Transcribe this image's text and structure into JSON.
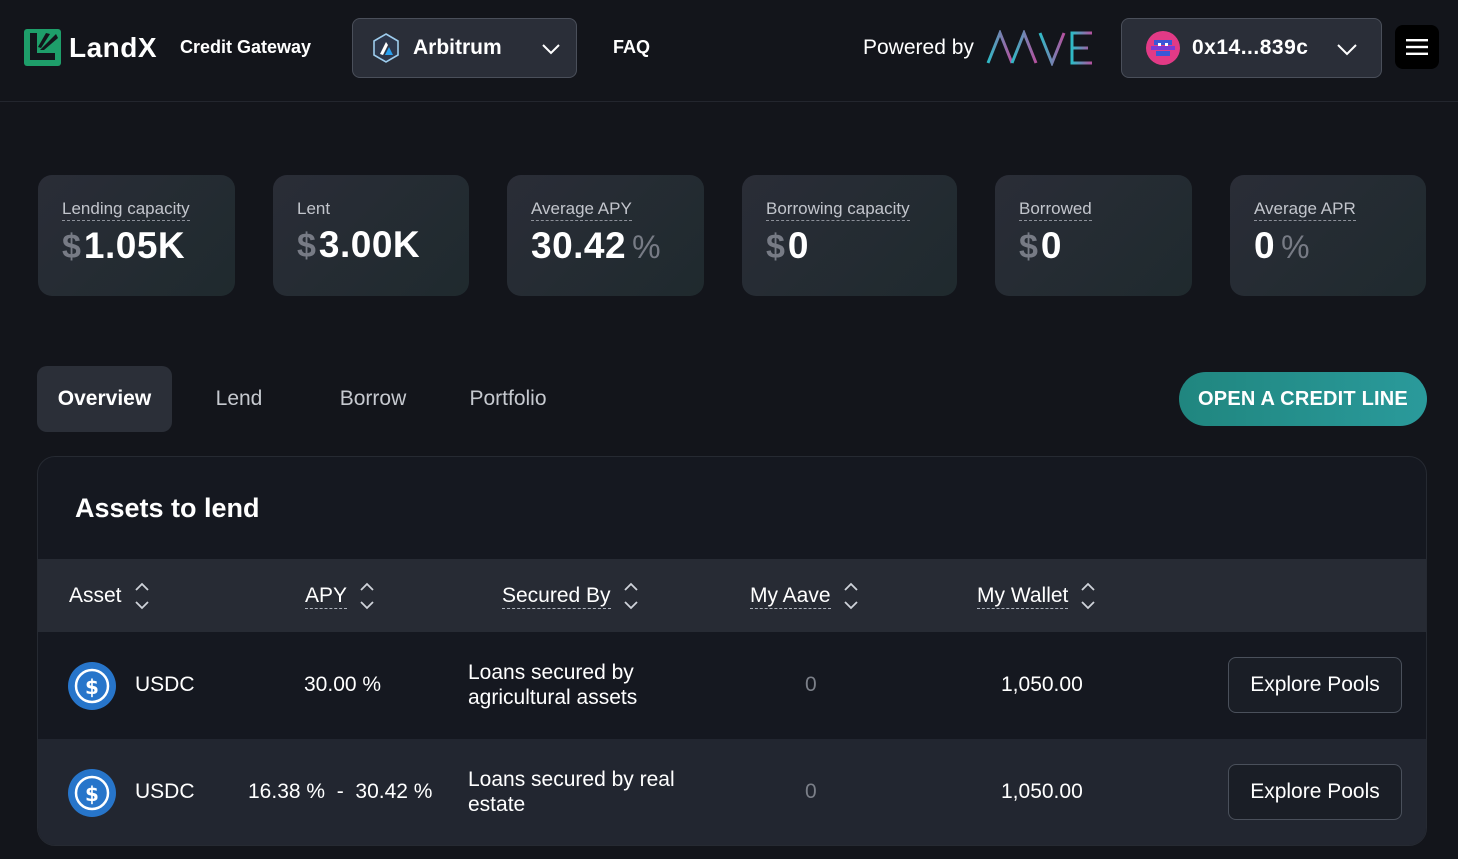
{
  "header": {
    "brand": "LandX",
    "product": "Credit Gateway",
    "network": "Arbitrum",
    "faq": "FAQ",
    "powered_by": "Powered by",
    "wallet_address": "0x14...839c"
  },
  "stats": [
    {
      "label": "Lending capacity",
      "prefix": "$",
      "value": "1.05K",
      "suffix": ""
    },
    {
      "label": "Lent",
      "prefix": "$",
      "value": "3.00K",
      "suffix": ""
    },
    {
      "label": "Average APY",
      "prefix": "",
      "value": "30.42",
      "suffix": "%"
    },
    {
      "label": "Borrowing capacity",
      "prefix": "$",
      "value": "0",
      "suffix": ""
    },
    {
      "label": "Borrowed",
      "prefix": "$",
      "value": "0",
      "suffix": ""
    },
    {
      "label": "Average APR",
      "prefix": "",
      "value": "0",
      "suffix": "%"
    }
  ],
  "tabs": [
    "Overview",
    "Lend",
    "Borrow",
    "Portfolio"
  ],
  "active_tab": "Overview",
  "cta": "OPEN A CREDIT LINE",
  "assets_panel": {
    "title": "Assets to lend",
    "columns": [
      "Asset",
      "APY",
      "Secured By",
      "My Aave",
      "My Wallet"
    ],
    "rows": [
      {
        "asset": "USDC",
        "apy": "30.00 %",
        "secured_by": "Loans secured by agricultural assets",
        "my_aave": "0",
        "my_wallet": "1,050.00",
        "action": "Explore Pools"
      },
      {
        "asset": "USDC",
        "apy": "16.38 %  -  30.42 %",
        "secured_by": "Loans secured by real estate",
        "my_aave": "0",
        "my_wallet": "1,050.00",
        "action": "Explore Pools"
      }
    ]
  },
  "colors": {
    "background": "#13151b",
    "card": "#2a2d37",
    "accent_teal": "#20867f",
    "brand_green": "#1e9e6a",
    "usdc_blue": "#2775ca"
  }
}
